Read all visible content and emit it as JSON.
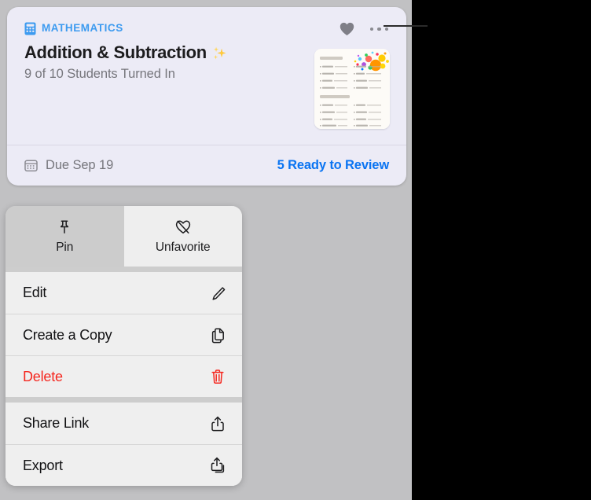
{
  "card": {
    "subject_icon": "calculator-icon",
    "subject": "MATHEMATICS",
    "title": "Addition & Subtraction",
    "title_emoji": "sparkles-icon",
    "subtitle": "9 of 10 Students Turned In",
    "favorite_icon": "heart-filled-icon",
    "more_icon": "ellipsis-icon",
    "thumbnail": {
      "alt": "worksheet-thumbnail",
      "section_1": "ADDITION",
      "section_2": "SUBTRACTION"
    },
    "footer": {
      "due_icon": "calendar-icon",
      "due_label": "Due Sep 19",
      "review_label": "5 Ready to Review"
    }
  },
  "context_menu": {
    "top_actions": [
      {
        "label": "Pin",
        "icon": "pin-icon",
        "state": "pressed"
      },
      {
        "label": "Unfavorite",
        "icon": "heart-slash-icon",
        "state": "normal"
      }
    ],
    "groups": [
      {
        "items": [
          {
            "label": "Edit",
            "icon": "pencil-icon",
            "danger": false
          },
          {
            "label": "Create a Copy",
            "icon": "duplicate-icon",
            "danger": false
          },
          {
            "label": "Delete",
            "icon": "trash-icon",
            "danger": true
          }
        ]
      },
      {
        "items": [
          {
            "label": "Share Link",
            "icon": "share-icon",
            "danger": false
          },
          {
            "label": "Export",
            "icon": "export-icon",
            "danger": false
          }
        ]
      }
    ]
  },
  "colors": {
    "accent_blue": "#0a74f2",
    "subject_blue": "#3d9bf0",
    "danger_red": "#f5271f",
    "card_bg": "#ecebf6",
    "backdrop": "#c1c1c3",
    "menu_bg": "#efefef"
  }
}
